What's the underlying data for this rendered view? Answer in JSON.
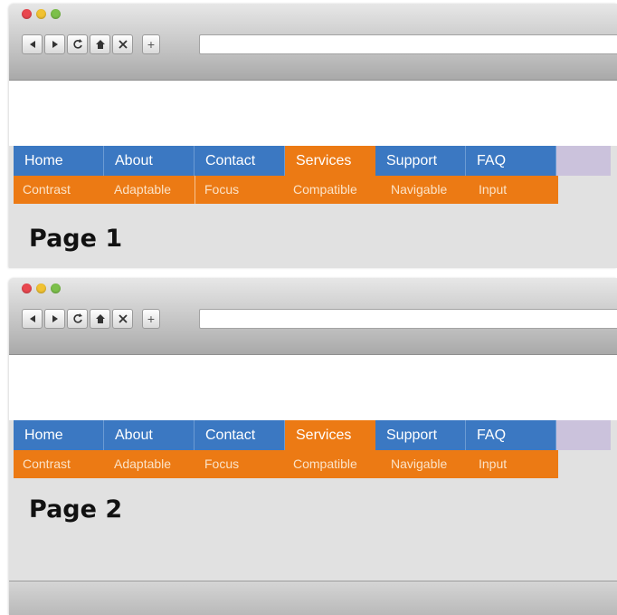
{
  "windows": [
    {
      "nav": [
        "Home",
        "About",
        "Contact",
        "Services",
        "Support",
        "FAQ"
      ],
      "active_nav": "Services",
      "subnav": [
        "Contrast",
        "Adaptable",
        "Focus",
        "Compatible",
        "Navigable",
        "Input"
      ],
      "page_label": "Page 1"
    },
    {
      "nav": [
        "Home",
        "About",
        "Contact",
        "Services",
        "Support",
        "FAQ"
      ],
      "active_nav": "Services",
      "subnav": [
        "Contrast",
        "Adaptable",
        "Focus",
        "Compatible",
        "Navigable",
        "Input"
      ],
      "page_label": "Page 2"
    }
  ],
  "toolbar": {
    "back_icon": "back-icon",
    "forward_icon": "forward-icon",
    "reload_icon": "reload-icon",
    "home_icon": "home-icon",
    "stop_icon": "close-icon",
    "new_tab_label": "+"
  },
  "colors": {
    "nav_blue": "#3b78c2",
    "nav_active_orange": "#ec7a14",
    "subnav_orange": "#ec7a14",
    "nav_filler": "#cbc2dc"
  }
}
